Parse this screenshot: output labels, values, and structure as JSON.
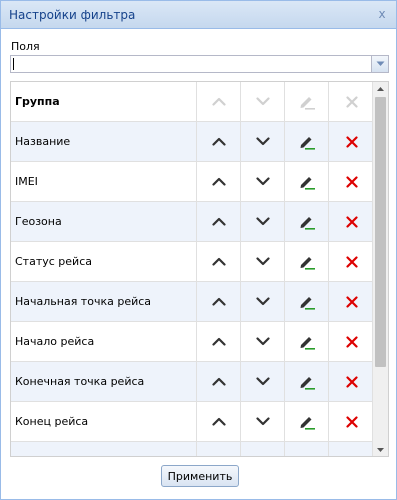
{
  "dialog": {
    "title": "Настройки фильтра",
    "close_glyph": "x"
  },
  "fields": {
    "label": "Поля",
    "value": ""
  },
  "grid": {
    "rows": [
      {
        "label": "Группа",
        "bold": true,
        "enabled": false
      },
      {
        "label": "Название",
        "bold": false,
        "enabled": true
      },
      {
        "label": "IMEI",
        "bold": false,
        "enabled": true
      },
      {
        "label": "Геозона",
        "bold": false,
        "enabled": true
      },
      {
        "label": "Статус рейса",
        "bold": false,
        "enabled": true
      },
      {
        "label": "Начальная точка рейса",
        "bold": false,
        "enabled": true
      },
      {
        "label": "Начало рейса",
        "bold": false,
        "enabled": true
      },
      {
        "label": "Конечная точка рейса",
        "bold": false,
        "enabled": true
      },
      {
        "label": "Конец рейса",
        "bold": false,
        "enabled": true
      },
      {
        "label": "",
        "bold": false,
        "enabled": true
      }
    ],
    "icons": [
      "chevron-up-icon",
      "chevron-down-icon",
      "pencil-icon",
      "delete-x-icon"
    ]
  },
  "footer": {
    "apply_label": "Применить"
  },
  "colors": {
    "title_text": "#15428b",
    "icon_active": "#333333",
    "icon_disabled": "#d0d0d0",
    "delete_active": "#dd0000",
    "pencil_underline": "#2a9d2a",
    "row_alt_bg": "#eef3fb"
  }
}
